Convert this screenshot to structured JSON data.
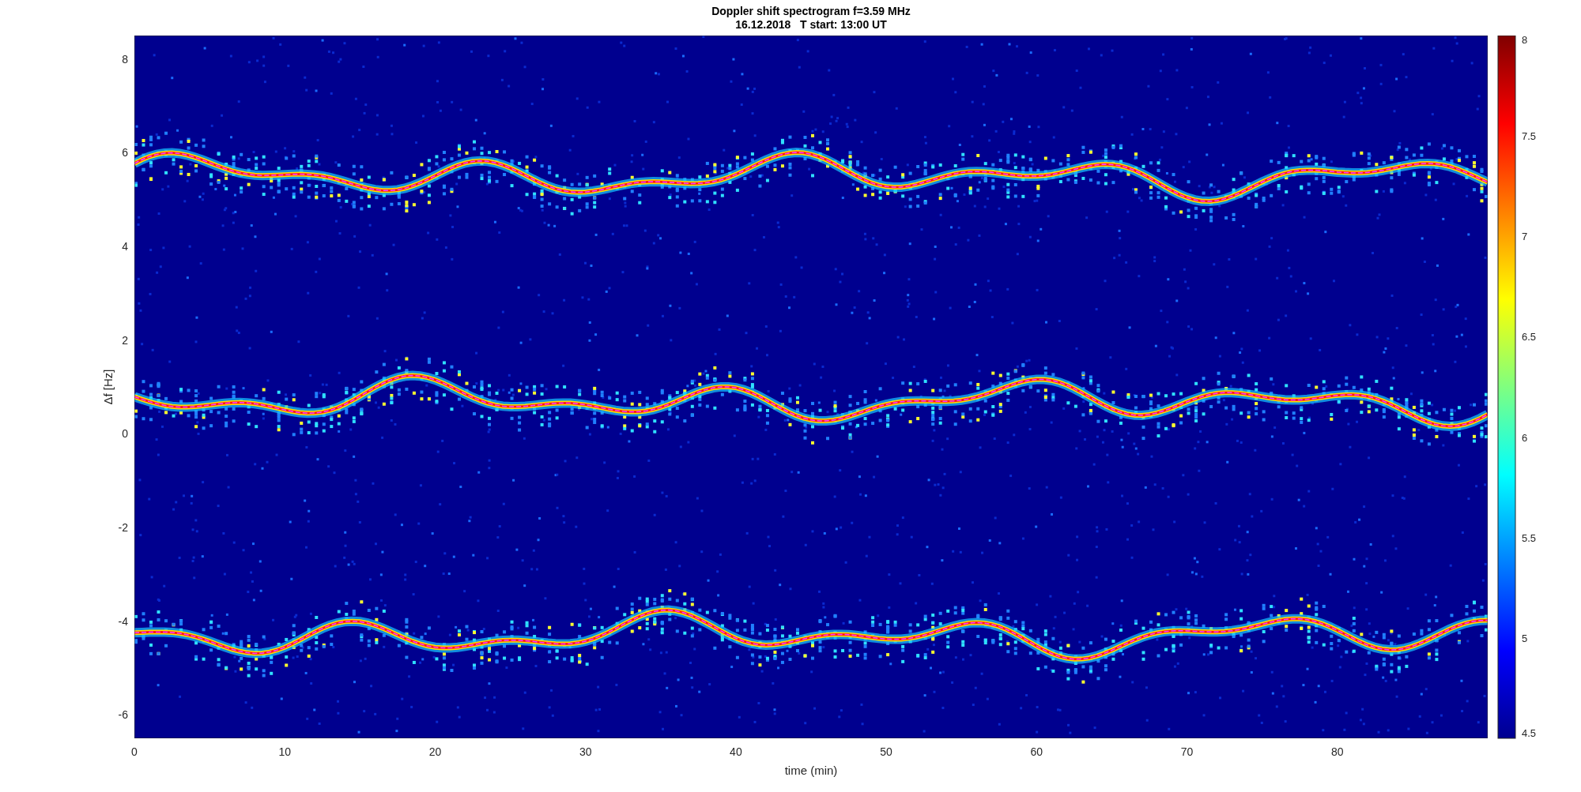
{
  "figure": {
    "title": "Doppler shift spectrogram f=3.59 MHz",
    "subtitle": "16.12.2018   T start: 13:00 UT"
  },
  "axes": {
    "xlabel": "time (min)",
    "ylabel": "Δf [Hz]",
    "xticks": [
      "0",
      "10",
      "20",
      "30",
      "40",
      "50",
      "60",
      "70",
      "80"
    ],
    "yticks": [
      "8",
      "6",
      "4",
      "2",
      "0",
      "-2",
      "-4",
      "-6"
    ]
  },
  "colorbar": {
    "ticks": [
      "8",
      "7.5",
      "7",
      "6.5",
      "6",
      "5.5",
      "5",
      "4.5"
    ]
  }
}
